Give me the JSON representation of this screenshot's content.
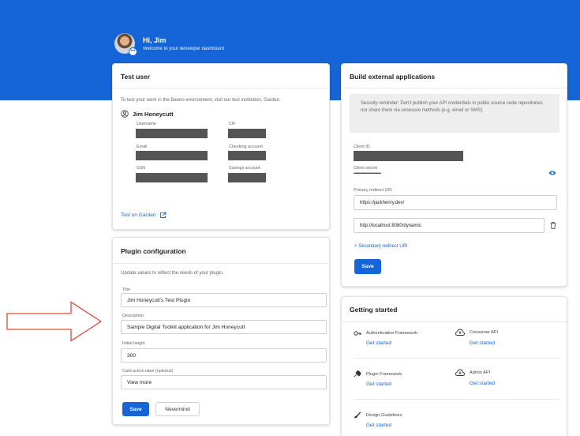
{
  "header": {
    "greeting": "Hi, Jim",
    "subtitle": "Welcome to your developer dashboard",
    "background_color": "#1565d8"
  },
  "test_user": {
    "title": "Test user",
    "intro": "To test your work in the Banno environment, visit our test institution, Garden.",
    "user_name": "Jim Honeycutt",
    "fields": {
      "username": "Username",
      "cif": "CIF",
      "email": "Email",
      "checking_account": "Checking account",
      "ssn": "SSN",
      "savings_account": "Savings account"
    },
    "link_label": "Test on Garden",
    "icons": {
      "user": "user-circle-icon",
      "external": "external-link-icon"
    }
  },
  "plugin": {
    "title": "Plugin configuration",
    "intro": "Update values to reflect the needs of your plugin.",
    "title_label": "Title",
    "title_value": "Jim Honeycutt's Test Plugin",
    "description_label": "Description",
    "description_value": "Sample Digital Toolkit application for Jim Honeycutt",
    "height_label": "Initial height",
    "height_value": "300",
    "card_action_label": "Card action label (optional)",
    "card_action_value": "View more",
    "save_label": "Save",
    "cancel_label": "Nevermind"
  },
  "build": {
    "title": "Build external applications",
    "reminder": "Security reminder: Don't publish your API credentials in public source code repositories nor share them via unsecure methods (e.g. email or SMS).",
    "client_id_label": "Client ID",
    "client_secret_label": "Client secret",
    "client_secret_value": "••••••••••••••••••••••••••••••",
    "primary_redirect_label": "Primary redirect URI",
    "primary_redirect_value": "https://jackhenry.dev/",
    "secondary_redirect_value": "http://localhost:8080/dynamic",
    "add_secondary_label": "+ Secondary redirect URI",
    "save_label": "Save",
    "icons": {
      "reveal": "eye-icon",
      "delete": "trash-icon"
    }
  },
  "getting_started": {
    "title": "Getting started",
    "items": [
      {
        "name": "Authentication Framework",
        "action": "Get started",
        "icon": "key-icon"
      },
      {
        "name": "Consumer API",
        "action": "Get started",
        "icon": "api-cloud-icon"
      },
      {
        "name": "Plugin Framework",
        "action": "Get started",
        "icon": "plugin-icon"
      },
      {
        "name": "Admin API",
        "action": "Get started",
        "icon": "api-cloud-icon"
      },
      {
        "name": "Design Guidelines",
        "action": "Get started",
        "icon": "paint-icon"
      }
    ]
  },
  "annotation": {
    "arrow_fill": "#ffffff",
    "arrow_stroke": "#e04a3a"
  }
}
